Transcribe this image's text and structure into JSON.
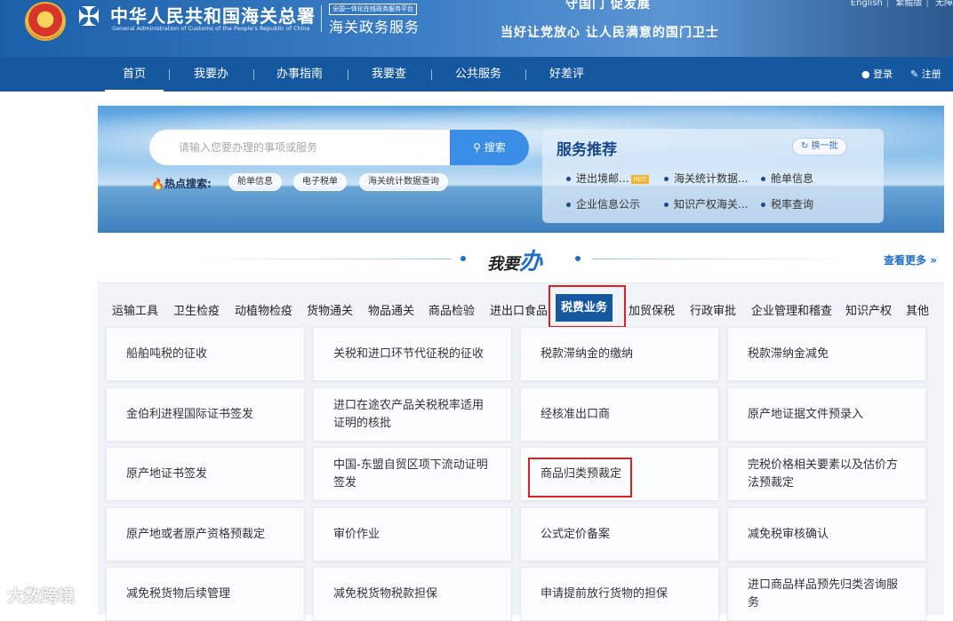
{
  "header": {
    "org_title": "中华人民共和国海关总署",
    "org_en": "General Administration of Customs of the People's Republic of China",
    "platform_tag": "全国一体化在线政务服务平台",
    "platform_name": "海关政务服务",
    "slogan_top": "守国门  促发展",
    "slogan_bottom": "当好让党放心  让人民满意的国门卫士",
    "lang_links": [
      "English",
      "繁體版",
      "无障"
    ]
  },
  "nav": {
    "items": [
      "首页",
      "我要办",
      "办事指南",
      "我要查",
      "公共服务",
      "好差评"
    ],
    "active": "首页",
    "login": "登录",
    "register": "注册"
  },
  "search": {
    "placeholder": "请输入您要办理的事项或服务",
    "button": "搜索",
    "hot_label": "热点搜索:",
    "hot_items": [
      "舱单信息",
      "电子税单",
      "海关统计数据查询"
    ]
  },
  "recommend": {
    "title": "服务推荐",
    "refresh": "换一批",
    "items": [
      "进出境邮...",
      "海关统计数据...",
      "舱单信息",
      "企业信息公示",
      "知识产权海关...",
      "税率查询"
    ],
    "hot_badge": "HOT"
  },
  "section": {
    "title_prefix": "我要",
    "title_big": "办",
    "more": "查看更多"
  },
  "tabs": {
    "items": [
      "运输工具",
      "卫生检疫",
      "动植物检疫",
      "货物通关",
      "物品通关",
      "商品检验",
      "进出口食品",
      "税费业务",
      "加贸保税",
      "行政审批",
      "企业管理和稽查",
      "知识产权",
      "其他"
    ],
    "active": "税费业务"
  },
  "cards": [
    "船舶吨税的征收",
    "关税和进口环节代征税的征收",
    "税款滞纳金的缴纳",
    "税款滞纳金减免",
    "金伯利进程国际证书签发",
    "进口在途农产品关税税率适用证明的核批",
    "经核准出口商",
    "原产地证据文件预录入",
    "原产地证书签发",
    "中国-东盟自贸区项下流动证明签发",
    "商品归类预裁定",
    "完税价格相关要素以及估价方法预裁定",
    "原产地或者原产资格预裁定",
    "审价作业",
    "公式定价备案",
    "减免税审核确认",
    "减免税货物后续管理",
    "减免税货物税款担保",
    "申请提前放行货物的担保",
    "进口商品样品预先归类咨询服务"
  ],
  "watermark": "大数跨境",
  "colors": {
    "nav_bg": "#1658a0",
    "accent": "#1f6fc5",
    "search_btn": "#3a8ee6",
    "highlight_box": "#e02020",
    "hot_badge": "#f7b32b"
  }
}
